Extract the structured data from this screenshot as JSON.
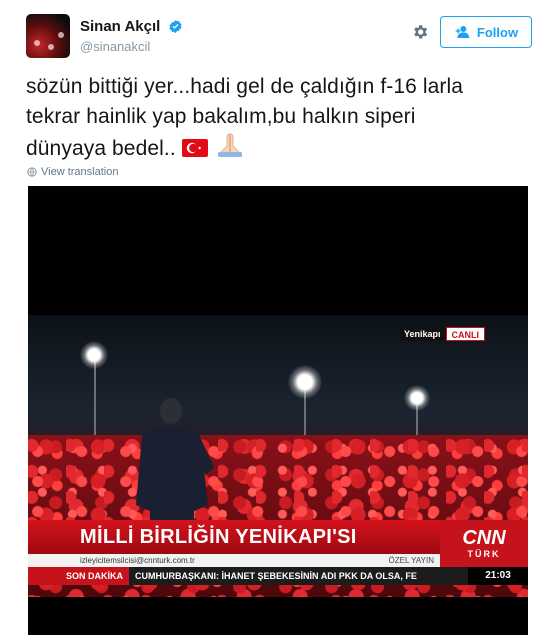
{
  "author": {
    "display_name": "Sinan Akçıl",
    "handle": "@sinanakcil",
    "verified": true
  },
  "actions": {
    "follow_label": "Follow",
    "settings_icon": "gear-icon"
  },
  "tweet": {
    "line1": "sözün bittiği yer...hadi gel de çaldığın f-16 larla",
    "line2": "tekrar hainlik yap bakalım,bu halkın siperi",
    "line3": "dünyaya bedel..",
    "emojis": [
      "turkish-flag-emoji",
      "folded-hands-emoji"
    ]
  },
  "translate": {
    "label": "View translation"
  },
  "video": {
    "location": "Yenikapı",
    "live_badge": "CANLI",
    "headline": "MİLLİ BİRLİĞİN YENİKAPI'SI",
    "email": "izleyicitemsilcisi@cnnturk.com.tr",
    "special": "ÖZEL YAYIN",
    "brand_top": "CNN",
    "brand_bottom": "TÜRK",
    "ticker_label": "SON DAKİKA",
    "ticker_text": "CUMHURBAŞKANI: İHANET ŞEBEKESİNİN ADI PKK DA OLSA, FE",
    "clock": "21:03"
  },
  "colors": {
    "twitter_blue": "#1da1f2",
    "cnn_red": "#c5121b"
  }
}
